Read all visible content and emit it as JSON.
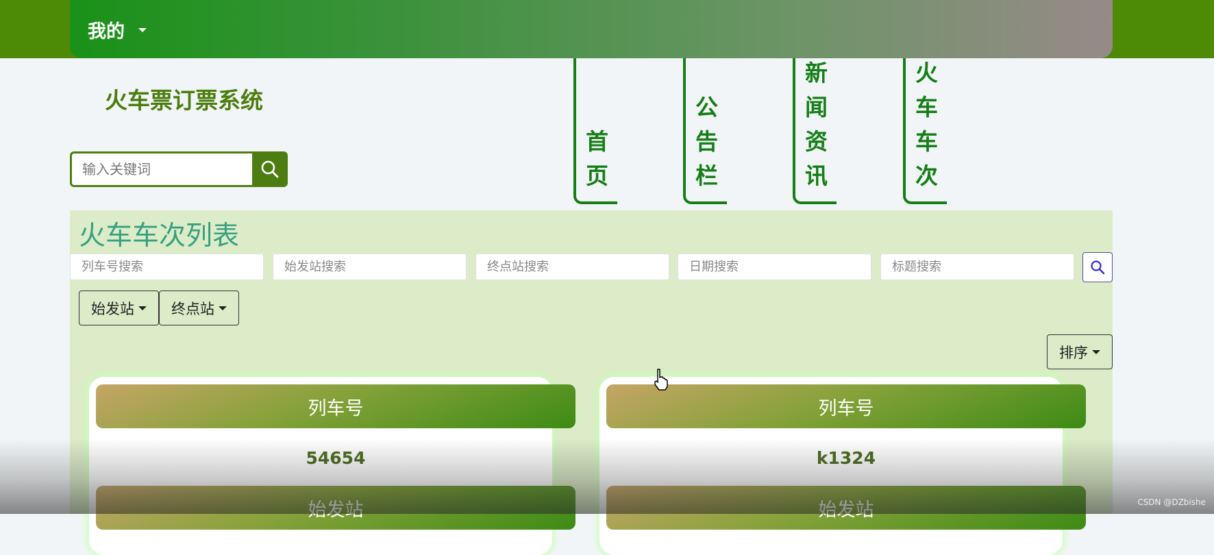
{
  "topbar": {
    "user_menu_label": "我的"
  },
  "header": {
    "site_title": "火车票订票系统",
    "search_placeholder": "输入关键词"
  },
  "nav": [
    {
      "label": "首页"
    },
    {
      "label": "公告栏"
    },
    {
      "label": "新闻资讯"
    },
    {
      "label": "火车车次"
    }
  ],
  "list": {
    "title": "火车车次列表",
    "filters": [
      {
        "placeholder": "列车号搜索"
      },
      {
        "placeholder": "始发站搜索"
      },
      {
        "placeholder": "终点站搜索"
      },
      {
        "placeholder": "日期搜索"
      },
      {
        "placeholder": "标题搜索"
      }
    ],
    "dropdowns": [
      {
        "label": "始发站"
      },
      {
        "label": "终点站"
      }
    ],
    "sort_label": "排序"
  },
  "cards": [
    {
      "train_no_label": "列车号",
      "train_no": "54654",
      "origin_label": "始发站"
    },
    {
      "train_no_label": "列车号",
      "train_no": "k1324",
      "origin_label": "始发站"
    }
  ],
  "watermark": "CSDN @DZbishe",
  "colors": {
    "primary": "#4d7d11",
    "nav_green": "#157e16",
    "panel_bg": "#dcecc8",
    "title_teal": "#38a080"
  }
}
